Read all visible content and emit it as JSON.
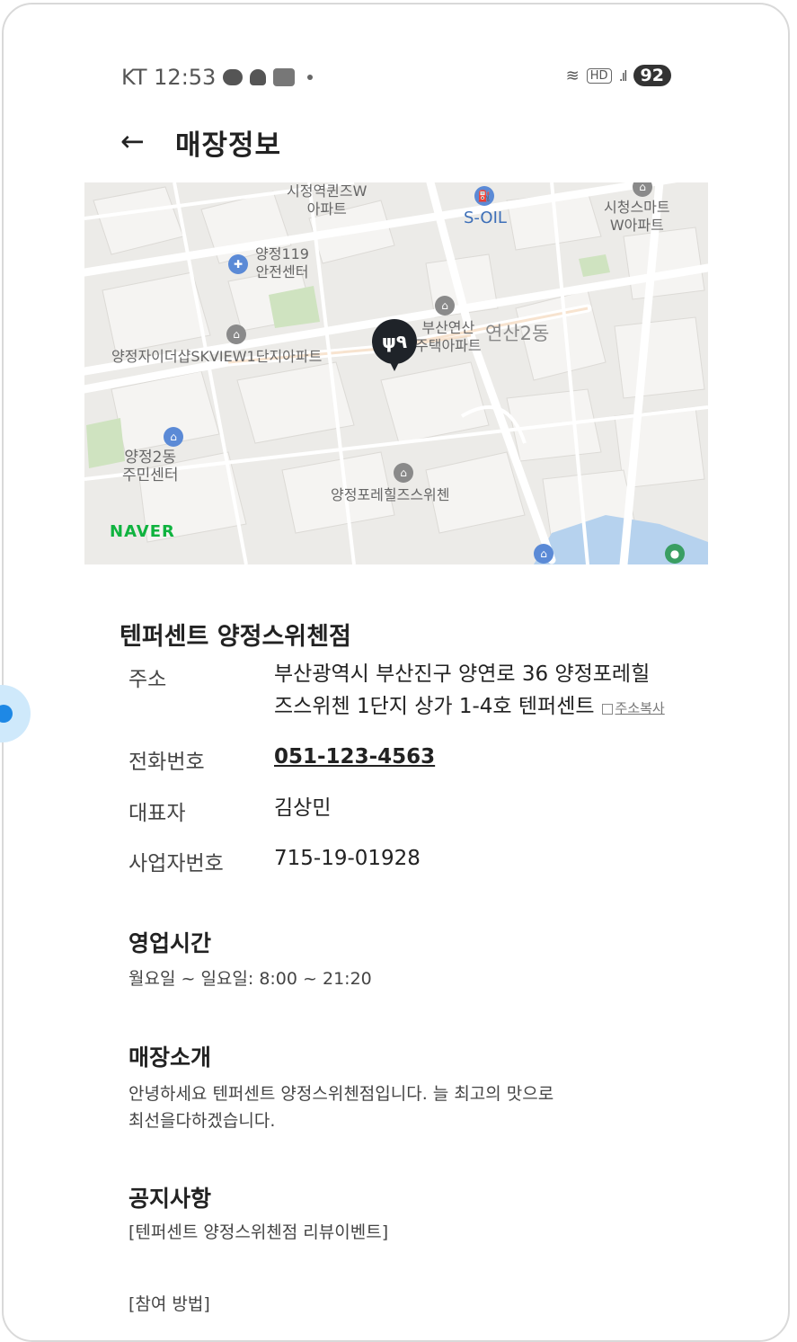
{
  "status_bar": {
    "carrier_time": "KT 12:53",
    "hd": "HD",
    "battery": "92"
  },
  "header": {
    "back_icon": "←",
    "title": "매장정보"
  },
  "map": {
    "labels": {
      "apt_queensw": "시정역퀸즈W\n아파트",
      "soil": "S-OIL",
      "city_smart": "시청스마트\nW아파트",
      "safety_center": "양정119\n안전센터",
      "yeonsan_apt": "부산연산\n주택아파트",
      "yeonsan2dong": "연산2동",
      "skview": "양정자이더샵SKVIEW1단지아파트",
      "community_center": "양정2동\n주민센터",
      "porehill": "양정포레힐즈스위첸"
    },
    "watermark": "NAVER",
    "pin_icon": "fork-knife-icon"
  },
  "store": {
    "name": "텐퍼센트 양정스위첸점",
    "address_label": "주소",
    "address_line1": "부산광역시 부산진구 양연로 36 양정포레힐",
    "address_line2": "즈스위첸 1단지 상가 1-4호 텐퍼센트",
    "copy_label": "주소복사",
    "phone_label": "전화번호",
    "phone": "051-123-4563",
    "owner_label": "대표자",
    "owner": "김상민",
    "biz_label": "사업자번호",
    "biz_no": "715-19-01928"
  },
  "hours": {
    "title": "영업시간",
    "text": "월요일 ~ 일요일: 8:00 ~ 21:20"
  },
  "intro": {
    "title": "매장소개",
    "text": "안녕하세요 텐퍼센트 양정스위첸점입니다. 늘 최고의 맛으로\n최선을다하겠습니다."
  },
  "notice": {
    "title": "공지사항",
    "line1": "[텐퍼센트 양정스위첸점 리뷰이벤트]",
    "line2": "[참여 방법]"
  }
}
